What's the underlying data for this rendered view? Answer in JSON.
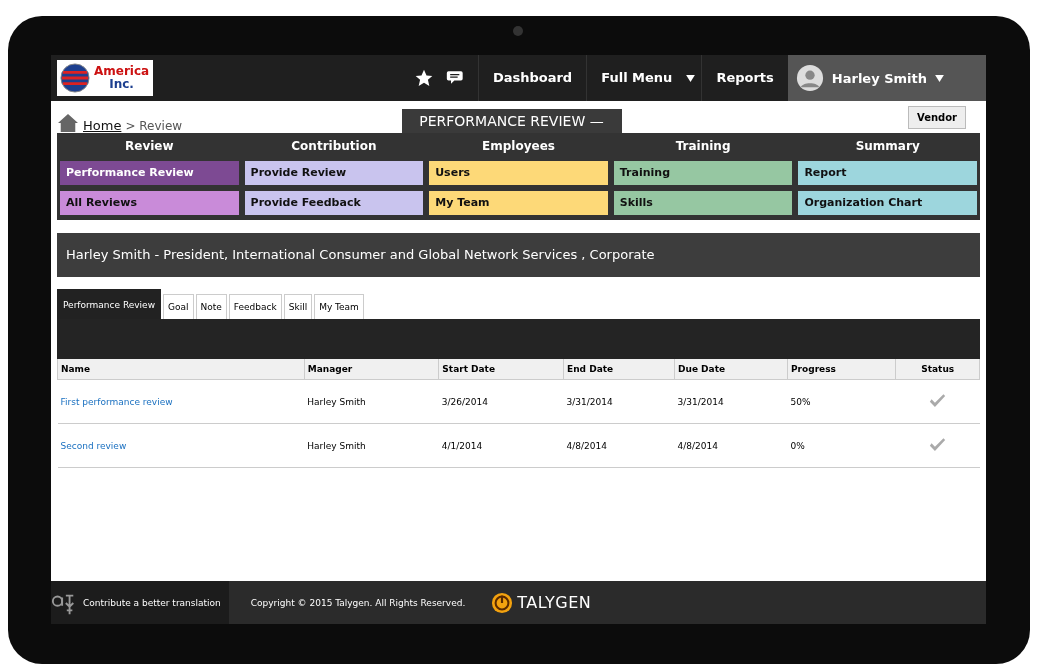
{
  "header": {
    "logo_text": [
      "America",
      "Inc."
    ],
    "nav": [
      "Dashboard",
      "Full Menu",
      "Reports"
    ],
    "user": "Harley Smith"
  },
  "breadcrumb": {
    "home": "Home",
    "separator": ">",
    "current": "Review"
  },
  "page_title": "PERFORMANCE REVIEW —",
  "vendor_button": "Vendor",
  "menu": [
    {
      "heading": "Review",
      "items": [
        {
          "label": "Performance Review",
          "color": "#7d4a93"
        },
        {
          "label": "All Reviews",
          "color": "#c98bd9"
        }
      ]
    },
    {
      "heading": "Contribution",
      "items": [
        {
          "label": "Provide Review",
          "color": "#c9c4ee"
        },
        {
          "label": "Provide Feedback",
          "color": "#c9c4ee"
        }
      ]
    },
    {
      "heading": "Employees",
      "items": [
        {
          "label": "Users",
          "color": "#fdd978"
        },
        {
          "label": "My Team",
          "color": "#fdd978"
        }
      ]
    },
    {
      "heading": "Training",
      "items": [
        {
          "label": "Training",
          "color": "#96c7a2"
        },
        {
          "label": "Skills",
          "color": "#96c7a2"
        }
      ]
    },
    {
      "heading": "Summary",
      "items": [
        {
          "label": "Report",
          "color": "#9dd6dd"
        },
        {
          "label": "Organization Chart",
          "color": "#9dd6dd"
        }
      ]
    }
  ],
  "banner": "Harley Smith - President, International Consumer and Global Network Services , Corporate",
  "tabs": [
    {
      "label": "Performance Review",
      "selected": true
    },
    {
      "label": "Goal",
      "selected": false
    },
    {
      "label": "Note",
      "selected": false
    },
    {
      "label": "Feedback",
      "selected": false
    },
    {
      "label": "Skill",
      "selected": false
    },
    {
      "label": "My Team",
      "selected": false
    }
  ],
  "table": {
    "columns": [
      "Name",
      "Manager",
      "Start Date",
      "End Date",
      "Due Date",
      "Progress",
      "Status"
    ],
    "rows": [
      {
        "name": "First performance review",
        "manager": "Harley Smith",
        "start": "3/26/2014",
        "end": "3/31/2014",
        "due": "3/31/2014",
        "progress": "50%"
      },
      {
        "name": "Second review",
        "manager": "Harley Smith",
        "start": "4/1/2014",
        "end": "4/8/2014",
        "due": "4/8/2014",
        "progress": "0%"
      }
    ]
  },
  "footer": {
    "translate": "Contribute a better translation",
    "copyright": "Copyright © 2015 Talygen. All Rights Reserved.",
    "brand": "TALYGEN"
  }
}
